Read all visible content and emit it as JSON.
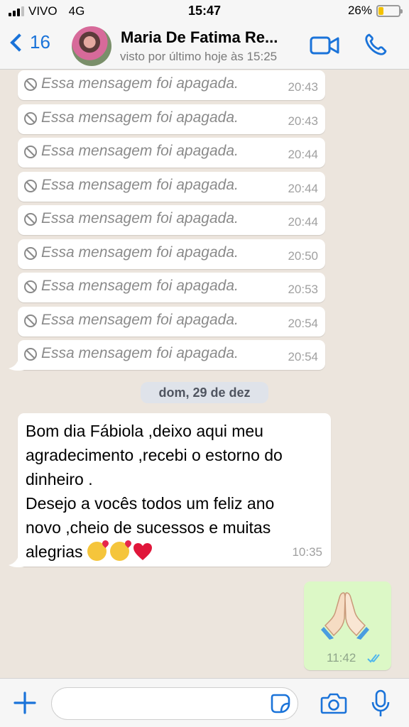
{
  "status_bar": {
    "carrier": "VIVO",
    "network": "4G",
    "time": "15:47",
    "battery_percent": "26%",
    "battery_level": 0.26,
    "signal_bars": 3
  },
  "header": {
    "back_count": "16",
    "contact_name": "Maria De Fatima Re...",
    "last_seen": "visto por último hoje às 15:25",
    "accent_color": "#1a73d9"
  },
  "deleted_messages": [
    {
      "text": "Essa mensagem foi apagada.",
      "time": "20:43"
    },
    {
      "text": "Essa mensagem foi apagada.",
      "time": "20:43"
    },
    {
      "text": "Essa mensagem foi apagada.",
      "time": "20:44"
    },
    {
      "text": "Essa mensagem foi apagada.",
      "time": "20:44"
    },
    {
      "text": "Essa mensagem foi apagada.",
      "time": "20:44"
    },
    {
      "text": "Essa mensagem foi apagada.",
      "time": "20:50"
    },
    {
      "text": "Essa mensagem foi apagada.",
      "time": "20:53"
    },
    {
      "text": "Essa mensagem foi apagada.",
      "time": "20:54"
    },
    {
      "text": "Essa mensagem foi apagada.",
      "time": "20:54"
    }
  ],
  "date_separator": "dom, 29 de dez",
  "incoming_message": {
    "lines": [
      "Bom dia Fábiola ,deixo aqui meu",
      "agradecimento ,recebi o estorno do",
      "dinheiro .",
      "Desejo a vocês todos um feliz ano",
      "novo ,cheio de sucessos e muitas",
      "alegrias "
    ],
    "emojis": [
      "kissing-face-icon",
      "kissing-face-icon",
      "red-heart-icon"
    ],
    "time": "10:35"
  },
  "outgoing_message": {
    "emoji": "folded-hands-icon",
    "time": "11:42",
    "status": "read",
    "tick_color": "#4fb6ec"
  },
  "input_bar": {
    "placeholder": "",
    "value": ""
  },
  "colors": {
    "chat_background": "#ece5dd",
    "outgoing_bubble": "#dcf8c6",
    "incoming_bubble": "#ffffff",
    "icon_blue": "#1a73d9"
  }
}
